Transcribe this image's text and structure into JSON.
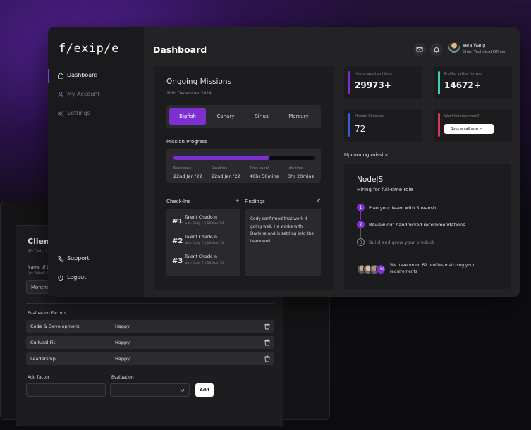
{
  "app": {
    "logo": "f/exip/e",
    "page_title": "Dashboard",
    "user": {
      "name": "Vera Wang",
      "role": "Chief Technical Officer"
    }
  },
  "sidebar": {
    "items": [
      {
        "label": "Dashboard",
        "icon": "home-icon",
        "active": true
      },
      {
        "label": "My Account",
        "icon": "user-icon",
        "active": false
      },
      {
        "label": "Settings",
        "icon": "gear-icon",
        "active": false
      }
    ],
    "bottom": [
      {
        "label": "Support",
        "icon": "phone-icon"
      },
      {
        "label": "Logout",
        "icon": "power-icon"
      }
    ]
  },
  "missions": {
    "title": "Ongoing Missions",
    "date": "20th December 2024",
    "tabs": [
      "Bigfish",
      "Canary",
      "Sirius",
      "Mercury"
    ],
    "active_tab": "Bigfish",
    "progress_label": "Mission Progress",
    "progress_fraction": 0.68,
    "stats": [
      {
        "label": "Start date",
        "value": "22nd Jan '22"
      },
      {
        "label": "Deadline",
        "value": "22nd Jan '22"
      },
      {
        "label": "Time spent",
        "value": "46hr 56mins"
      },
      {
        "label": "Idle time",
        "value": "3hr 20mins"
      }
    ],
    "checkins_label": "Check-Ins",
    "checkins_action": "+",
    "checkins": [
      {
        "num": "#1",
        "title": "Talent Check-In",
        "sub": "with Cody F. | 16 Nov '24"
      },
      {
        "num": "#2",
        "title": "Talent Check-In",
        "sub": "with Cody F. | 16 Nov '24"
      },
      {
        "num": "#3",
        "title": "Talent Check-In",
        "sub": "with Cody F. | 16 Nov '24"
      }
    ],
    "findings_label": "Findings",
    "findings_text": "Cody confirmed that work if going well. He works with Darlene and is settling into the team well."
  },
  "stats_cards": [
    {
      "label": "Hours saved on hiring",
      "value": "29973+",
      "color": "#7d2fd0"
    },
    {
      "label": "Profiles vetted for you",
      "value": "14672+",
      "color": "#3fcfb4"
    },
    {
      "label": "Mission Checkins",
      "value": "72",
      "color": "#3b5bd6"
    },
    {
      "label": "Want to know more?",
      "button": "Book a call now  →",
      "color": "#d63b5b"
    }
  ],
  "upcoming": {
    "label": "Upcoming mission",
    "title": "NodeJS",
    "subtitle": "Hiring for full-time role",
    "steps": [
      {
        "n": "1",
        "text": "Plan your team with Suvansh",
        "done": true
      },
      {
        "n": "2",
        "text": "Review our handpicked recommendations",
        "done": true
      },
      {
        "n": "3",
        "text": "Build and grow your product",
        "done": false
      }
    ],
    "more_count": "+59",
    "found_text": "We have found 62 profiles matching your requirements"
  },
  "client_form": {
    "title": "Client",
    "date": "20 Dec, 2",
    "name_label": "Name of th",
    "name_sub": "(ex. Week 1",
    "period_value": "Monthly",
    "eval_heading": "Evaluation Factors",
    "factors": [
      {
        "factor": "Code & Development",
        "value": "Happy"
      },
      {
        "factor": "Cultural Fit",
        "value": "Happy"
      },
      {
        "factor": "Leadership",
        "value": "Happy"
      }
    ],
    "add_factor_label": "Add factor",
    "evaluation_label": "Evaluation",
    "add_button": "Add"
  }
}
